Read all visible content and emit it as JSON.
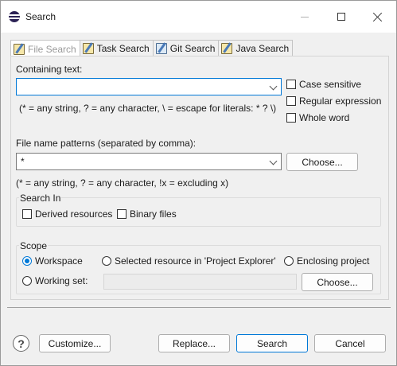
{
  "window": {
    "title": "Search"
  },
  "tabs": [
    {
      "label": "File Search",
      "icon": "file-search-icon"
    },
    {
      "label": "Task Search",
      "icon": "task-search-icon"
    },
    {
      "label": "Git Search",
      "icon": "git-search-icon"
    },
    {
      "label": "Java Search",
      "icon": "java-search-icon"
    }
  ],
  "containing": {
    "label": "Containing text:",
    "value": "",
    "hint": "(* = any string, ? = any character, \\ = escape for literals: * ? \\)",
    "case_sensitive": "Case sensitive",
    "regular_expression": "Regular expression",
    "whole_word": "Whole word"
  },
  "file_patterns": {
    "label": "File name patterns (separated by comma):",
    "value": "*",
    "choose": "Choose...",
    "hint": "(* = any string, ? = any character, !x = excluding x)"
  },
  "search_in": {
    "title": "Search In",
    "derived": "Derived resources",
    "binary": "Binary files"
  },
  "scope": {
    "title": "Scope",
    "workspace": "Workspace",
    "selected_resource": "Selected resource in 'Project Explorer'",
    "enclosing_project": "Enclosing project",
    "working_set": "Working set:",
    "choose": "Choose..."
  },
  "buttons": {
    "customize": "Customize...",
    "replace": "Replace...",
    "search": "Search",
    "cancel": "Cancel"
  },
  "colors": {
    "accent": "#0078d7"
  }
}
